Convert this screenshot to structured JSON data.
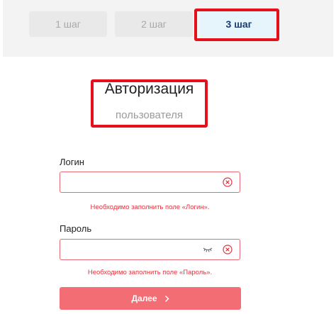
{
  "steps": [
    {
      "label": "1 шаг"
    },
    {
      "label": "2 шаг"
    },
    {
      "label": "3 шаг"
    }
  ],
  "title": "Авторизация",
  "subtitle": "пользователя",
  "login": {
    "label": "Логин",
    "value": "",
    "error": "Необходимо заполнить поле «Логин»."
  },
  "password": {
    "label": "Пароль",
    "value": "",
    "error": "Необходимо заполнить поле «Пароль»."
  },
  "next_button": {
    "label": "Далее"
  },
  "colors": {
    "accent": "#f26e74",
    "error": "#e2333d",
    "highlight": "#e5101b",
    "active_step_bg": "#e6f4fc",
    "active_step_text": "#1b3c6e"
  },
  "icons": [
    "clear-icon",
    "eye-closed-icon",
    "chevron-right-icon"
  ]
}
